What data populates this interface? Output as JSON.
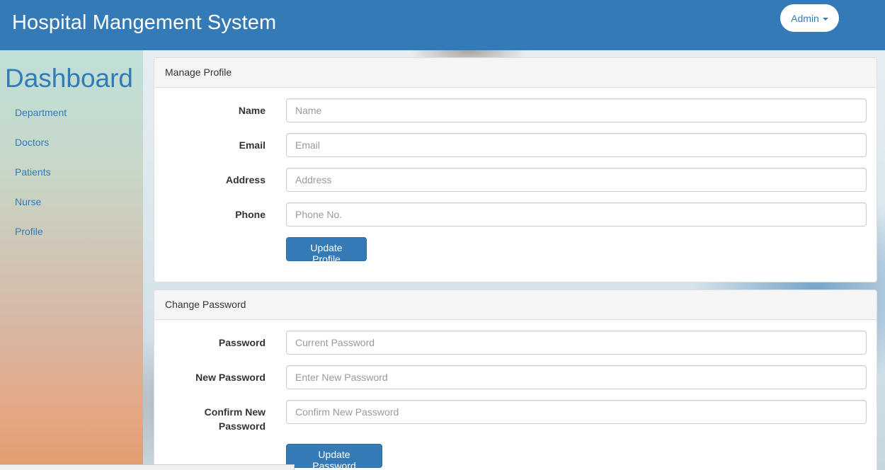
{
  "navbar": {
    "brand": "Hospital Mangement System",
    "user_menu_label": "Admin"
  },
  "sidebar": {
    "title": "Dashboard",
    "items": [
      {
        "label": "Department"
      },
      {
        "label": "Doctors"
      },
      {
        "label": "Patients"
      },
      {
        "label": "Nurse"
      },
      {
        "label": "Profile"
      }
    ]
  },
  "manage_profile": {
    "heading": "Manage Profile",
    "fields": [
      {
        "label": "Name",
        "placeholder": "Name",
        "value": ""
      },
      {
        "label": "Email",
        "placeholder": "Email",
        "value": ""
      },
      {
        "label": "Address",
        "placeholder": "Address",
        "value": ""
      },
      {
        "label": "Phone",
        "placeholder": "Phone No.",
        "value": ""
      }
    ],
    "submit_label": "Update Profile"
  },
  "change_password": {
    "heading": "Change Password",
    "fields": [
      {
        "label": "Password",
        "placeholder": "Current Password",
        "value": ""
      },
      {
        "label": "New Password",
        "placeholder": "Enter New Password",
        "value": ""
      },
      {
        "label": "Confirm New Password",
        "placeholder": "Confirm New Password",
        "value": ""
      }
    ],
    "submit_label": "Update Password"
  },
  "colors": {
    "primary": "#337ab7",
    "panel_heading_bg": "#f5f5f5",
    "border": "#dddddd"
  }
}
